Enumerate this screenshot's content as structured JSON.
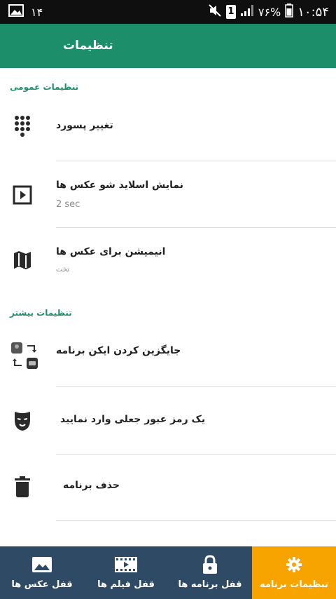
{
  "status_bar": {
    "notification_count": "۱۴",
    "sim_label": "1",
    "battery_percent": "۷۶%",
    "time": "۱۰:۵۴"
  },
  "app_bar": {
    "title": "تنظیمات"
  },
  "sections": [
    {
      "header": "تنظیمات عمومی",
      "items": [
        {
          "title": "تغییر پسورد",
          "subtitle": "",
          "icon": "dialpad-icon"
        },
        {
          "title": "نمایش اسلاید شو عکس ها",
          "subtitle": "2 sec",
          "icon": "slideshow-icon"
        },
        {
          "title": "انیمیشن برای عکس ها",
          "subtitle": "تخت",
          "icon": "map-icon"
        }
      ]
    },
    {
      "header": "تنظیمات بیشتر",
      "items": [
        {
          "title": "جایگزین کردن ایکن برنامه",
          "subtitle": "",
          "icon": "swap-app-icon"
        },
        {
          "title": "یک رمز عبور جعلی وارد نمایید",
          "subtitle": "",
          "icon": "mask-icon"
        },
        {
          "title": "حذف برنامه",
          "subtitle": "",
          "icon": "trash-icon"
        }
      ]
    }
  ],
  "bottom_nav": [
    {
      "label": "قفل عکس ها",
      "icon": "image-icon",
      "active": false
    },
    {
      "label": "قفل فیلم ها",
      "icon": "film-icon",
      "active": false
    },
    {
      "label": "قفل برنامه ها",
      "icon": "lock-icon",
      "active": false
    },
    {
      "label": "تنظیمات برنامه",
      "icon": "gear-icon",
      "active": true
    }
  ],
  "colors": {
    "primary": "#1d8e6a",
    "bottom_nav": "#2f4a64",
    "accent_active": "#f7a400"
  }
}
